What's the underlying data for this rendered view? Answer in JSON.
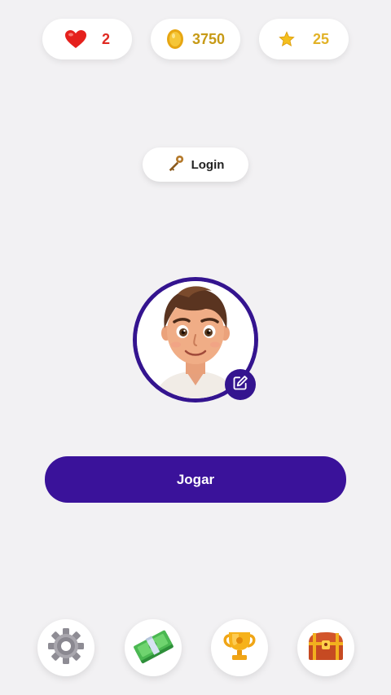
{
  "stats": {
    "lives": {
      "value": "2",
      "icon": "heart-icon",
      "color": "#e02a22"
    },
    "coins": {
      "value": "3750",
      "icon": "coin-icon",
      "color": "#c79a16"
    },
    "stars": {
      "value": "25",
      "icon": "star-icon",
      "color": "#e2b227"
    }
  },
  "login": {
    "label": "Login",
    "icon": "key-icon"
  },
  "profile": {
    "avatar_icon": "avatar-icon",
    "edit_icon": "edit-icon",
    "ring_color": "#34148f"
  },
  "play": {
    "label": "Jogar",
    "color": "#3a129a"
  },
  "bottom_nav": [
    {
      "name": "settings",
      "icon": "gear-icon"
    },
    {
      "name": "shop",
      "icon": "money-icon"
    },
    {
      "name": "trophy",
      "icon": "trophy-icon"
    },
    {
      "name": "chest",
      "icon": "chest-icon"
    }
  ]
}
